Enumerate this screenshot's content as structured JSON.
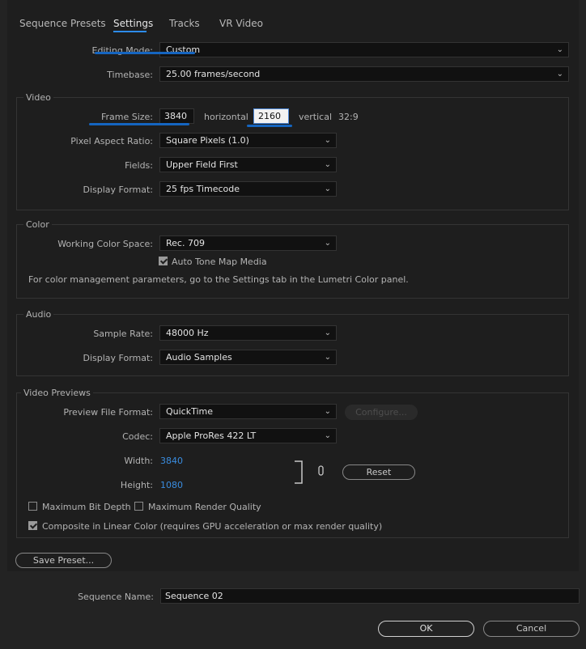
{
  "tabs": [
    {
      "label": "Sequence Presets"
    },
    {
      "label": "Settings"
    },
    {
      "label": "Tracks"
    },
    {
      "label": "VR Video"
    }
  ],
  "editing_mode": {
    "label": "Editing Mode:",
    "value": "Custom"
  },
  "timebase": {
    "label": "Timebase:",
    "value": "25.00  frames/second"
  },
  "video": {
    "title": "Video",
    "frame_size_label": "Frame Size:",
    "frame_width": "3840",
    "horizontal_label": "horizontal",
    "frame_height": "2160",
    "vertical_label": "vertical",
    "aspect": "32:9",
    "pixel_aspect": {
      "label": "Pixel Aspect Ratio:",
      "value": "Square Pixels (1.0)"
    },
    "fields": {
      "label": "Fields:",
      "value": "Upper Field First"
    },
    "display_format": {
      "label": "Display Format:",
      "value": "25 fps Timecode"
    }
  },
  "color": {
    "title": "Color",
    "working_space": {
      "label": "Working Color Space:",
      "value": "Rec. 709"
    },
    "auto_tone_map": {
      "label": "Auto Tone Map Media",
      "checked": true
    },
    "note": "For color management parameters, go to the Settings tab in the Lumetri Color panel."
  },
  "audio": {
    "title": "Audio",
    "sample_rate": {
      "label": "Sample Rate:",
      "value": "48000 Hz"
    },
    "display_format": {
      "label": "Display Format:",
      "value": "Audio Samples"
    }
  },
  "previews": {
    "title": "Video Previews",
    "file_format": {
      "label": "Preview File Format:",
      "value": "QuickTime"
    },
    "configure_label": "Configure...",
    "codec": {
      "label": "Codec:",
      "value": "Apple ProRes 422 LT"
    },
    "width": {
      "label": "Width:",
      "value": "3840"
    },
    "height": {
      "label": "Height:",
      "value": "1080"
    },
    "reset_label": "Reset"
  },
  "options": {
    "max_bit_depth": {
      "label": "Maximum Bit Depth",
      "checked": false
    },
    "max_render_quality": {
      "label": "Maximum Render Quality",
      "checked": false
    },
    "linear_color": {
      "label": "Composite in Linear Color (requires GPU acceleration or max render quality)",
      "checked": true
    }
  },
  "save_preset_label": "Save Preset...",
  "sequence_name": {
    "label": "Sequence Name:",
    "value": "Sequence 02"
  },
  "ok_label": "OK",
  "cancel_label": "Cancel",
  "colors": {
    "accent": "#2d8ceb",
    "annotation": "#1565c0",
    "value_blue": "#3a8de0"
  }
}
